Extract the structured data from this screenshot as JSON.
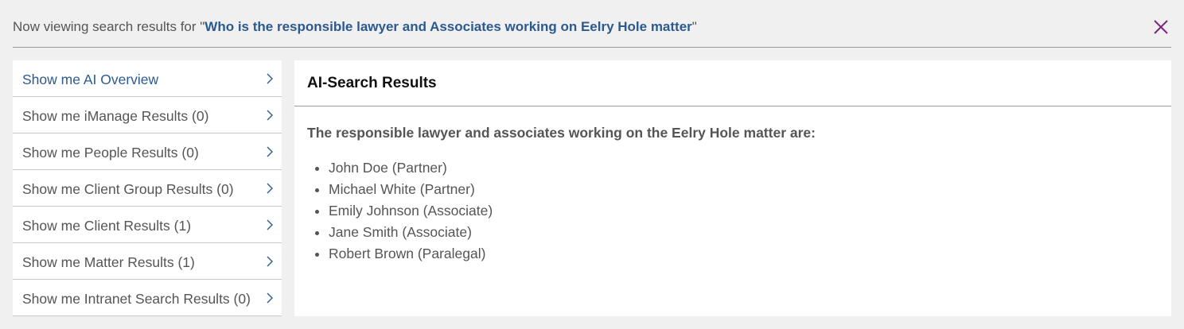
{
  "header": {
    "prefix": "Now viewing search results for \"",
    "query": "Who is the responsible lawyer and Associates working on Eelry Hole matter",
    "suffix": "\"",
    "accent_color": "#2c5a8f",
    "close_icon": "close-icon",
    "close_icon_color": "#7a2a7a"
  },
  "sidebar": {
    "items": [
      {
        "label": "Show me AI Overview",
        "active": true
      },
      {
        "label": "Show me iManage Results (0)",
        "active": false
      },
      {
        "label": "Show me People Results (0)",
        "active": false
      },
      {
        "label": "Show me Client Group Results (0)",
        "active": false
      },
      {
        "label": "Show me Client Results (1)",
        "active": false
      },
      {
        "label": "Show me Matter Results (1)",
        "active": false
      },
      {
        "label": "Show me Intranet Search Results (0)",
        "active": false
      }
    ],
    "item_icon": "chevron-right-icon"
  },
  "main": {
    "title": "AI-Search Results",
    "summary": "The responsible lawyer and associates working on the Eelry Hole matter are:",
    "people": [
      "John Doe (Partner)",
      "Michael White (Partner)",
      "Emily Johnson (Associate)",
      "Jane Smith (Associate)",
      "Robert Brown (Paralegal)"
    ]
  }
}
